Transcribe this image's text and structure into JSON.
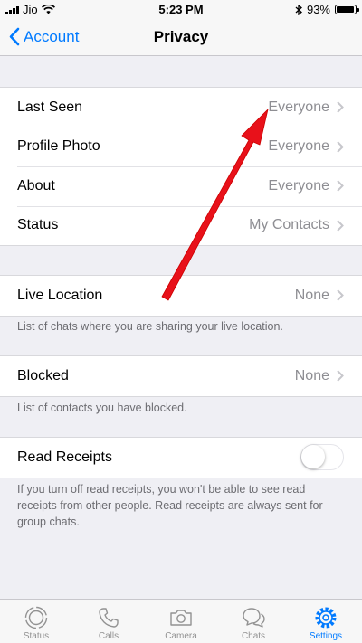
{
  "status_bar": {
    "carrier": "Jio",
    "time": "5:23 PM",
    "battery": "93%",
    "battery_level": 0.93,
    "icons": [
      "signal-icon",
      "wifi-icon",
      "bluetooth-icon",
      "battery-icon"
    ]
  },
  "nav": {
    "back_label": "Account",
    "title": "Privacy"
  },
  "group1": [
    {
      "label": "Last Seen",
      "value": "Everyone"
    },
    {
      "label": "Profile Photo",
      "value": "Everyone"
    },
    {
      "label": "About",
      "value": "Everyone"
    },
    {
      "label": "Status",
      "value": "My Contacts"
    }
  ],
  "live_location": {
    "label": "Live Location",
    "value": "None",
    "footer": "List of chats where you are sharing your live location."
  },
  "blocked": {
    "label": "Blocked",
    "value": "None",
    "footer": "List of contacts you have blocked."
  },
  "read_receipts": {
    "label": "Read Receipts",
    "enabled": false,
    "footer": "If you turn off read receipts, you won't be able to see read receipts from other people. Read receipts are always sent for group chats."
  },
  "tab_bar": [
    {
      "label": "Status",
      "icon": "status-icon",
      "active": false
    },
    {
      "label": "Calls",
      "icon": "phone-icon",
      "active": false
    },
    {
      "label": "Camera",
      "icon": "camera-icon",
      "active": false
    },
    {
      "label": "Chats",
      "icon": "chats-icon",
      "active": false
    },
    {
      "label": "Settings",
      "icon": "gear-icon",
      "active": true
    }
  ],
  "colors": {
    "accent": "#007aff",
    "annotation_arrow": "#e8111a",
    "background": "#efeff4"
  }
}
